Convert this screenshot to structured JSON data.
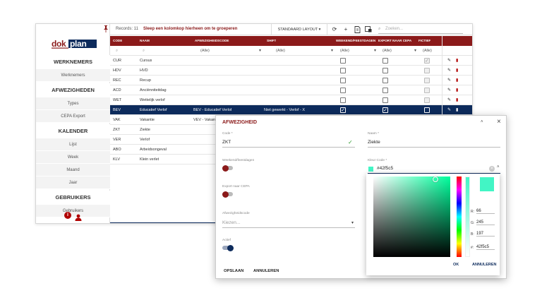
{
  "app": {
    "logo_text": "dokplan",
    "colors": {
      "primary": "#8b1a1a",
      "selected": "#0d2b5c",
      "picked": "#42f5c5"
    }
  },
  "sidebar": {
    "sections": [
      {
        "title": "WERKNEMERS",
        "items": [
          "Werknemers"
        ]
      },
      {
        "title": "AFWEZIGHEDEN",
        "items": [
          "Types",
          "CEPA Export"
        ]
      },
      {
        "title": "KALENDER",
        "items": [
          "Lijst",
          "Week",
          "Maand",
          "Jaar"
        ]
      },
      {
        "title": "GEBRUIKERS",
        "items": [
          "Gebruikers"
        ]
      }
    ],
    "footer_icons": [
      "info-icon",
      "user-icon"
    ]
  },
  "toolbar": {
    "records": "Records: 11",
    "group_hint": "Sleep een kolomkop hierheen om te groeperen",
    "layout_label": "STANDAARD LAYOUT",
    "search_placeholder": "Zoeken..."
  },
  "grid": {
    "columns": [
      "CODE",
      "NAAM",
      "AFWEZIGHEIDSCODE",
      "SHIFT",
      "WEEKEND/FEESTDAGEN",
      "EXPORT NAAR CEPA",
      "FICTIEF"
    ],
    "filter_all": "(Alle)",
    "rows": [
      {
        "code": "CUR",
        "naam": "Cursus",
        "afw": "",
        "shift": "",
        "weekend": false,
        "export": false,
        "fictief": true,
        "actions": true
      },
      {
        "code": "HDV",
        "naam": "HVD",
        "afw": "",
        "shift": "",
        "weekend": false,
        "export": false,
        "fictief": false,
        "actions": true
      },
      {
        "code": "REC",
        "naam": "Recup",
        "afw": "",
        "shift": "",
        "weekend": false,
        "export": false,
        "fictief": false,
        "actions": true
      },
      {
        "code": "ACD",
        "naam": "Anciënniteitdag",
        "afw": "",
        "shift": "",
        "weekend": false,
        "export": false,
        "fictief": false,
        "actions": true
      },
      {
        "code": "WET",
        "naam": "Wettelijk verlof",
        "afw": "",
        "shift": "",
        "weekend": false,
        "export": false,
        "fictief": false,
        "actions": true
      },
      {
        "code": "BEV",
        "naam": "Educatief Verlof",
        "afw": "BEV - Educatief Verlof",
        "shift": "Niet gewerkt - Verlof - X",
        "weekend": true,
        "export": true,
        "fictief": false,
        "actions": true,
        "selected": true
      },
      {
        "code": "VAK",
        "naam": "Vakantie",
        "afw": "VEV - Vakan",
        "shift": "",
        "weekend": false,
        "export": false,
        "fictief": false,
        "actions": false
      },
      {
        "code": "ZKT",
        "naam": "Ziekte",
        "afw": "",
        "shift": "",
        "weekend": false,
        "export": false,
        "fictief": false,
        "actions": false
      },
      {
        "code": "VER",
        "naam": "Verlof",
        "afw": "",
        "shift": "",
        "weekend": false,
        "export": false,
        "fictief": false,
        "actions": false
      },
      {
        "code": "ABO",
        "naam": "Arbeidsongeval",
        "afw": "",
        "shift": "",
        "weekend": false,
        "export": false,
        "fictief": false,
        "actions": false
      },
      {
        "code": "KLV",
        "naam": "Klein verlet",
        "afw": "",
        "shift": "",
        "weekend": false,
        "export": false,
        "fictief": false,
        "actions": false
      }
    ]
  },
  "modal": {
    "title": "AFWEZIGHEID",
    "code_label": "Code *",
    "code_value": "ZKT",
    "naam_label": "Naam *",
    "naam_value": "Ziekte",
    "weekend_label": "Weekend/feestdagen",
    "export_label": "Export naar CEPA",
    "kleur_label": "Kleur Code *",
    "kleur_value": "#42f5c5",
    "afw_label": "Afwezigheidscode",
    "afw_placeholder": "Kiezen...",
    "actief_label": "Actief",
    "save": "OPSLAAN",
    "cancel": "ANNULEREN"
  },
  "picker": {
    "r_label": "R:",
    "r": "66",
    "g_label": "G:",
    "g": "245",
    "b_label": "B:",
    "b": "197",
    "hex_label": "#:",
    "hex": "42f5c5",
    "ok": "OK",
    "cancel": "ANNULEREN"
  }
}
